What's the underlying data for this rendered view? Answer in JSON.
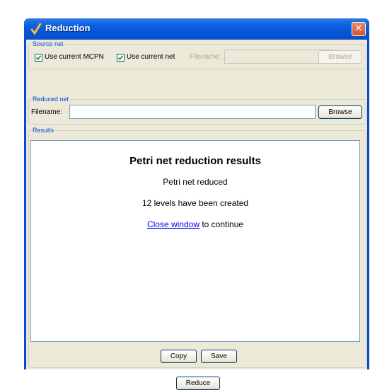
{
  "window": {
    "title": "Reduction",
    "close_glyph": "✕"
  },
  "source_net": {
    "legend": "Source net",
    "use_current_mcpn": {
      "label": "Use current MCPN",
      "checked": true
    },
    "use_current_net": {
      "label": "Use current net",
      "checked": true
    },
    "filename_label": "Filename:",
    "filename_value": "",
    "browse_label": "Browse"
  },
  "reduced_net": {
    "legend": "Reduced net",
    "filename_label": "Filename:",
    "filename_value": "",
    "browse_label": "Browse"
  },
  "results": {
    "legend": "Results",
    "heading": "Petri net reduction results",
    "line1": "Petri net reduced",
    "line2": "12 levels have been created",
    "link_text": "Close window",
    "link_suffix": " to continue",
    "copy_label": "Copy",
    "save_label": "Save"
  },
  "footer": {
    "reduce_label": "Reduce"
  },
  "colors": {
    "title_bar": "#0554d6",
    "legend": "#0046d5",
    "link": "#0000ee"
  }
}
